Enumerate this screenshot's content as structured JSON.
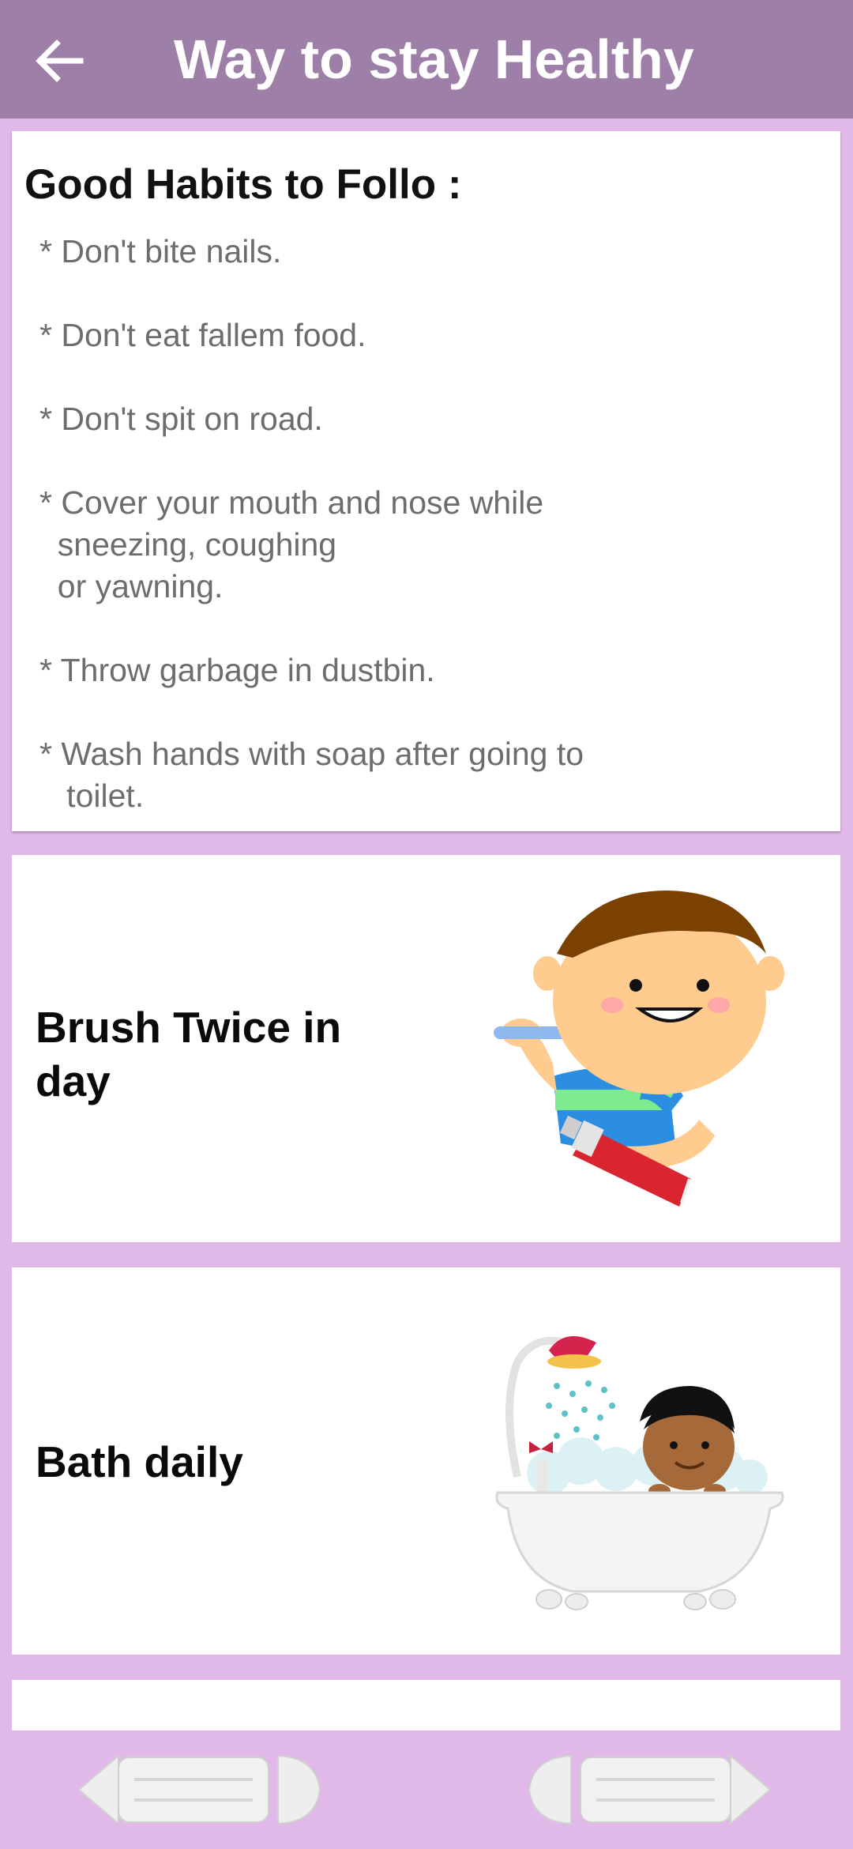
{
  "app_bar": {
    "title": "Way to stay Healthy",
    "back_icon": "arrow-left-icon",
    "background": "#9E7FA8"
  },
  "habits_card": {
    "heading": "Good Habits to Follo :",
    "items": [
      "* Don't bite nails.",
      "* Don't eat fallem food.",
      "* Don't spit on road.",
      "* Cover your mouth and nose while\n  sneezing, coughing\n  or yawning.",
      "* Throw garbage in dustbin.",
      "* Wash hands with soap after going to\n   toilet."
    ]
  },
  "cards": [
    {
      "label": "Brush Twice in day",
      "image": "boy-brushing-teeth-illustration"
    },
    {
      "label": "Bath daily",
      "image": "child-in-bathtub-illustration"
    }
  ],
  "bottom_nav": {
    "previous_icon": "previous-arrow-icon",
    "next_icon": "next-arrow-icon"
  },
  "colors": {
    "page_background": "#E1B9E8",
    "card_background": "#FFFFFF",
    "habit_text": "#6D6D6D"
  }
}
